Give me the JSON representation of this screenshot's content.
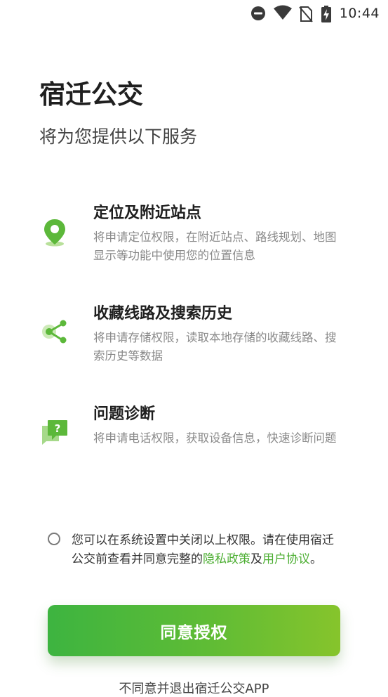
{
  "status_bar": {
    "time": "10:44",
    "icons": [
      "dnd-icon",
      "wifi-icon",
      "no-sim-icon",
      "battery-icon"
    ]
  },
  "header": {
    "title": "宿迁公交",
    "subtitle": "将为您提供以下服务"
  },
  "permissions": [
    {
      "icon": "location-pin-icon",
      "title": "定位及附近站点",
      "desc": "将申请定位权限，在附近站点、路线规划、地图显示等功能中使用您的位置信息"
    },
    {
      "icon": "share-nodes-icon",
      "title": "收藏线路及搜索历史",
      "desc": "将申请存储权限，读取本地存储的收藏线路、搜索历史等数据"
    },
    {
      "icon": "question-chat-icon",
      "title": "问题诊断",
      "desc": "将申请电话权限，获取设备信息，快速诊断问题"
    }
  ],
  "agreement": {
    "text_before": "您可以在系统设置中关闭以上权限。请在使用宿迁公交前查看并同意完整的",
    "privacy_link": "隐私政策",
    "and": "及",
    "user_link": "用户协议",
    "text_after": "。",
    "checked": false
  },
  "actions": {
    "agree_label": "同意授权",
    "reject_label": "不同意并退出宿迁公交APP"
  },
  "colors": {
    "accent": "#4cae32",
    "button_gradient_start": "#3db440",
    "button_gradient_end": "#86c42c"
  }
}
